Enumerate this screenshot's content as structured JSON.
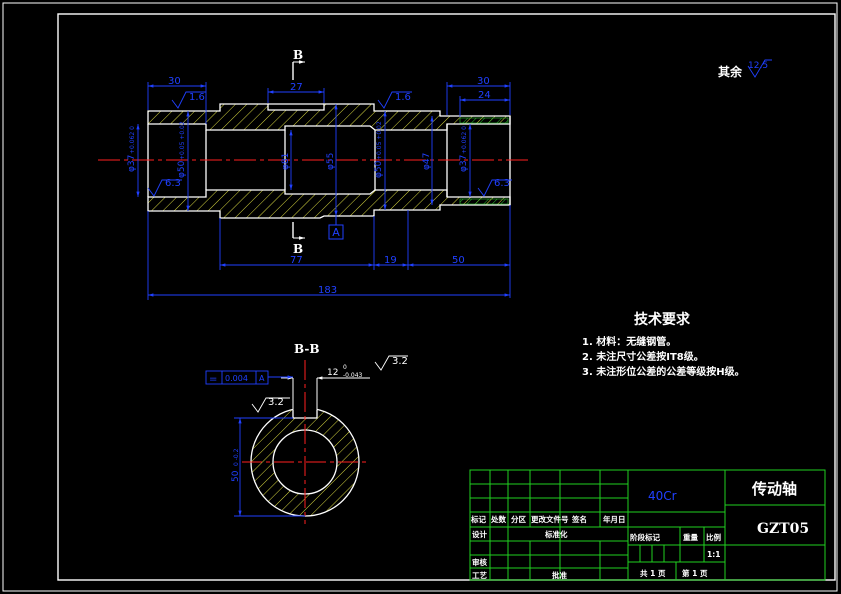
{
  "colors": {
    "background": "#000000",
    "frame": "#ffffff",
    "outline": "#ffffff",
    "hatch": "#e8e840",
    "dimension": "#2040ff",
    "centerline": "#ff2020",
    "title_block": "#20d020",
    "text": "#ffffff"
  },
  "main_view": {
    "section_label_top": "B",
    "section_label_bottom": "B",
    "datum_label": "A",
    "dim_left_30": "30",
    "dim_right_30": "30",
    "dim_key_27": "27",
    "dim_right_24": "24",
    "rough_left": "1.6",
    "rough_mid": "1.6",
    "rough_left_bore": "6.3",
    "rough_right_bore": "6.3",
    "dia_left_bore": "φ37",
    "dia_left_bore_tol": "+0.062 0",
    "dia_50_left": "φ50",
    "dia_50_left_tol": "+0.05 +0.02",
    "dia_81": "φ81",
    "dia_55": "φ55",
    "dia_50_right": "φ50",
    "dia_50_right_tol": "+0.05 +0.02",
    "dia_47": "φ47",
    "dia_right_bore": "φ37",
    "dia_right_bore_tol": "+0.062 0",
    "dim_77": "77",
    "dim_19": "19",
    "dim_50": "50",
    "dim_183": "183"
  },
  "rest_roughness": {
    "label": "其余",
    "value": "12.5"
  },
  "section_view": {
    "title": "B-B",
    "tolerance_symbol": "=",
    "tolerance_value": "0.004",
    "tolerance_datum": "A",
    "key_width": "12",
    "key_width_tol_upper": "0",
    "key_width_tol_lower": "-0.043",
    "rough_key": "3.2",
    "rough_bottom": "3.2",
    "depth_dim": "50",
    "depth_dim_tol": "0 -0.2"
  },
  "tech_requirements": {
    "title": "技术要求",
    "items": [
      "1.  材料：无缝钢管。",
      "2.  未注尺寸公差按IT8级。",
      "3.  未注形位公差的公差等级按H级。"
    ]
  },
  "title_block": {
    "material": "40Cr",
    "part_name": "传动轴",
    "drawing_no": "GZT05",
    "header_row": [
      "标记",
      "处数",
      "分区",
      "更改文件号",
      "签名",
      "年月日"
    ],
    "designer_label": "设计",
    "standardize_label": "标准化",
    "check_label": "审核",
    "process_label": "工艺",
    "approve_label": "批准",
    "stage_label": "阶段标记",
    "weight_label": "重量",
    "scale_label": "比例",
    "scale_value": "1:1",
    "sheet_total": "共 1 页",
    "sheet_no": "第 1 页"
  }
}
